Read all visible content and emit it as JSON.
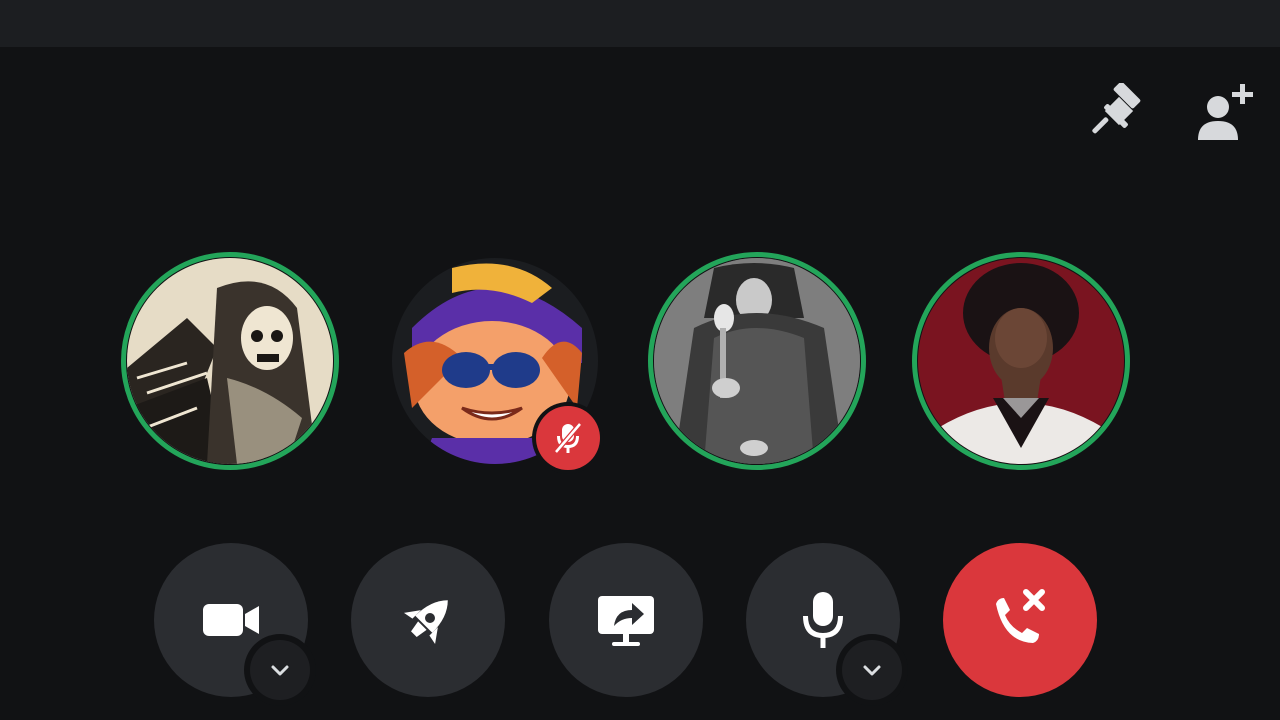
{
  "header": {
    "pin_icon": "pin-icon",
    "add_member_icon": "add-member-icon"
  },
  "participants": [
    {
      "id": "participant-1",
      "speaking": true,
      "muted": false,
      "avatar": "skull-reaper-sketch"
    },
    {
      "id": "participant-2",
      "speaking": false,
      "muted": true,
      "avatar": "cartoon-kid-sunglasses"
    },
    {
      "id": "participant-3",
      "speaking": true,
      "muted": false,
      "avatar": "grayscale-cloaked-figure"
    },
    {
      "id": "participant-4",
      "speaking": true,
      "muted": false,
      "avatar": "man-red-background"
    }
  ],
  "controls": {
    "camera_icon": "video-camera-icon",
    "activity_icon": "rocket-icon",
    "share_icon": "screen-share-icon",
    "mic_icon": "microphone-icon",
    "leave_icon": "hang-up-icon",
    "dropdown_icon": "chevron-down-icon"
  },
  "colors": {
    "background": "#111214",
    "speaking_ring": "#23a55a",
    "danger": "#da373c",
    "control_bg": "#2b2d31"
  }
}
